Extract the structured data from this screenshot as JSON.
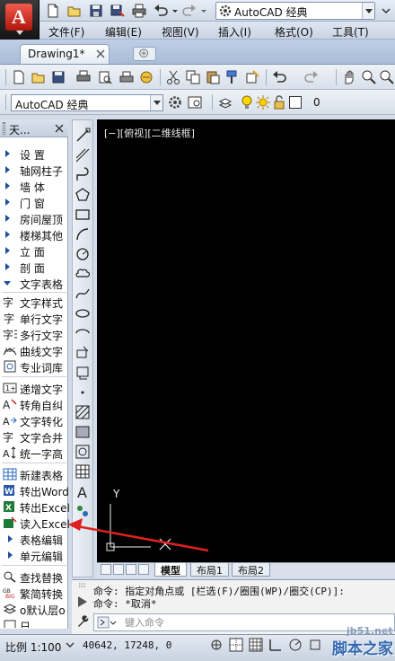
{
  "title_bar": {
    "workspace": "AutoCAD 经典"
  },
  "menu": {
    "items": [
      "文件(F)",
      "编辑(E)",
      "视图(V)",
      "插入(I)",
      "格式(O)",
      "工具(T)"
    ]
  },
  "doc_tab": {
    "label": "Drawing1*"
  },
  "workspace_toolbar": {
    "workspace": "AutoCAD 经典",
    "layer_value": "0"
  },
  "palette": {
    "title": "天...",
    "categories": [
      {
        "label": "设  置"
      },
      {
        "label": "轴网柱子"
      },
      {
        "label": "墙  体"
      },
      {
        "label": "门  窗"
      },
      {
        "label": "房间屋顶"
      },
      {
        "label": "楼梯其他"
      },
      {
        "label": "立  面"
      },
      {
        "label": "剖  面"
      },
      {
        "label": "文字表格"
      }
    ],
    "commands": [
      {
        "icon": "text-style-icon",
        "label": "文字样式"
      },
      {
        "icon": "single-line-text-icon",
        "label": "单行文字"
      },
      {
        "icon": "multiline-text-icon",
        "label": "多行文字"
      },
      {
        "icon": "curve-text-icon",
        "label": "曲线文字"
      },
      {
        "icon": "dictionary-icon",
        "label": "专业词库"
      },
      {
        "icon": "increment-text-icon",
        "label": "递增文字"
      },
      {
        "icon": "corner-text-icon",
        "label": "转角自纠"
      },
      {
        "icon": "text-convert-icon",
        "label": "文字转化"
      },
      {
        "icon": "text-merge-icon",
        "label": "文字合并"
      },
      {
        "icon": "unify-height-icon",
        "label": "统一字高"
      },
      {
        "icon": "new-table-icon",
        "label": "新建表格"
      },
      {
        "icon": "export-word-icon",
        "label": "转出Word"
      },
      {
        "icon": "export-excel-icon",
        "label": "转出Excel"
      },
      {
        "icon": "read-excel-icon",
        "label": "读入Excel"
      },
      {
        "icon": "table-edit-icon",
        "label": "表格编辑"
      },
      {
        "icon": "cell-edit-icon",
        "label": "单元编辑"
      },
      {
        "icon": "find-replace-icon",
        "label": "查找替换"
      },
      {
        "icon": "simp-trad-icon",
        "label": "繁简转换"
      },
      {
        "icon": "default-layer-icon",
        "label": "o默认层o"
      },
      {
        "icon": "misc-icon",
        "label": "日..."
      }
    ]
  },
  "canvas": {
    "viewport_label": "[−][俯视][二维线框]",
    "ucs_y": "Y",
    "background": "#000000"
  },
  "layout_tabs": [
    "模型",
    "布局1",
    "布局2"
  ],
  "command_line": {
    "line1": "命令: 指定对角点或 [栏选(F)/圈围(WP)/圈交(CP)]:",
    "line2": "命令: *取消*",
    "placeholder": "键入命令"
  },
  "status_bar": {
    "scale": "比例 1:100",
    "coords": "40642, 17248, 0"
  },
  "watermark": {
    "url": "jb51.net",
    "brand": "脚本之家"
  },
  "colors": {
    "accent": "#1d4f9c",
    "arrow": "#e02020",
    "app_red": "#c8200f"
  }
}
